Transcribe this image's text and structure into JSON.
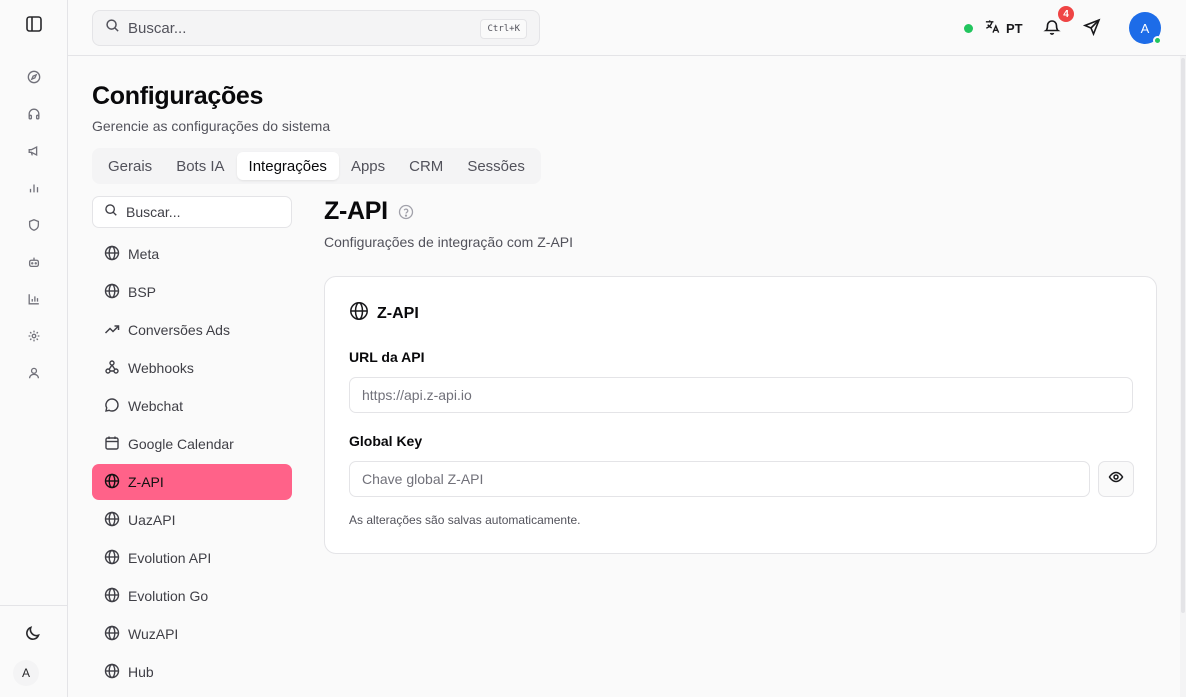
{
  "topbar": {
    "search_placeholder": "Buscar...",
    "search_shortcut": "Ctrl+K",
    "language": "PT",
    "notifications_count": "4",
    "user_initial": "A"
  },
  "rail": {
    "items": [
      "compass-icon",
      "headphones-icon",
      "megaphone-icon",
      "bar-chart-icon",
      "shield-icon",
      "bot-icon",
      "analytics-icon",
      "settings-icon",
      "user-icon"
    ],
    "avatar_initial": "A"
  },
  "page": {
    "title": "Configurações",
    "subtitle": "Gerencie as configurações do sistema",
    "tabs": [
      {
        "label": "Gerais",
        "active": false
      },
      {
        "label": "Bots IA",
        "active": false
      },
      {
        "label": "Integrações",
        "active": true
      },
      {
        "label": "Apps",
        "active": false
      },
      {
        "label": "CRM",
        "active": false
      },
      {
        "label": "Sessões",
        "active": false
      }
    ]
  },
  "integrations": {
    "search_placeholder": "Buscar...",
    "items": [
      {
        "label": "Meta",
        "icon": "globe-icon"
      },
      {
        "label": "BSP",
        "icon": "globe-icon"
      },
      {
        "label": "Conversões Ads",
        "icon": "trending-up-icon"
      },
      {
        "label": "Webhooks",
        "icon": "webhook-icon"
      },
      {
        "label": "Webchat",
        "icon": "chat-icon"
      },
      {
        "label": "Google Calendar",
        "icon": "calendar-icon"
      },
      {
        "label": "Z-API",
        "icon": "globe-icon",
        "active": true
      },
      {
        "label": "UazAPI",
        "icon": "globe-icon"
      },
      {
        "label": "Evolution API",
        "icon": "globe-icon"
      },
      {
        "label": "Evolution Go",
        "icon": "globe-icon"
      },
      {
        "label": "WuzAPI",
        "icon": "globe-icon"
      },
      {
        "label": "Hub",
        "icon": "globe-icon"
      }
    ]
  },
  "detail": {
    "title": "Z-API",
    "subtitle": "Configurações de integração com Z-API",
    "card_title": "Z-API",
    "url_label": "URL da API",
    "url_placeholder": "https://api.z-api.io",
    "key_label": "Global Key",
    "key_placeholder": "Chave global Z-API",
    "autosave_note": "As alterações são salvas automaticamente."
  },
  "colors": {
    "accent": "#ff6289",
    "online": "#22c55e",
    "badge": "#ef4444",
    "avatar": "#1d6ce8"
  }
}
